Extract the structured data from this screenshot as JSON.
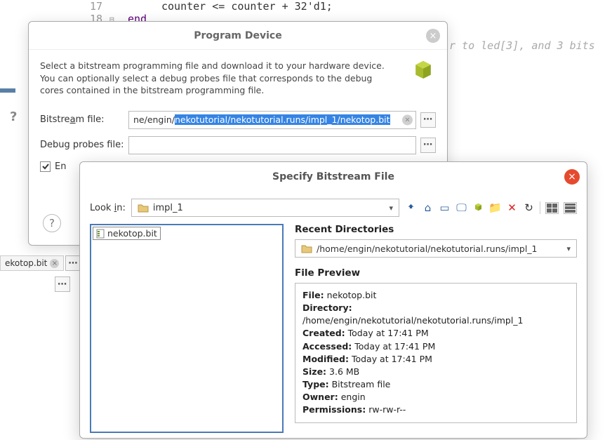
{
  "code": {
    "line17_num": "17",
    "line17_text": "counter <= counter + 32'd1;",
    "line18_num": "18",
    "line18_kw": "end"
  },
  "comment_right": "r to led[3], and 3 bits",
  "background_tab": {
    "label": "ekotop.bit"
  },
  "dlg1": {
    "title": "Program Device",
    "desc": "Select a bitstream programming file and download it to your hardware device. You can optionally select a debug probes file that corresponds to the debug cores contained in the bitstream programming file.",
    "bitstream_label": "Bitstream file:",
    "bitstream_prefix": "ne/engin/",
    "bitstream_sel": "nekotutorial/nekotutorial.runs/impl_1/nekotop.bit",
    "debug_label": "Debug probes file:",
    "debug_value": "",
    "checkbox_label": "En"
  },
  "dlg2": {
    "title": "Specify Bitstream File",
    "lookin_label": "Look in:",
    "lookin_value": "impl_1",
    "file_selected": "nekotop.bit",
    "recent_title": "Recent Directories",
    "recent_value": "/home/engin/nekotutorial/nekotutorial.runs/impl_1",
    "preview_title": "File Preview",
    "preview": {
      "file_k": "File:",
      "file_v": "nekotop.bit",
      "dir_k": "Directory:",
      "dir_v": "/home/engin/nekotutorial/nekotutorial.runs/impl_1",
      "created_k": "Created:",
      "created_v": "Today at 17:41 PM",
      "accessed_k": "Accessed:",
      "accessed_v": "Today at 17:41 PM",
      "modified_k": "Modified:",
      "modified_v": "Today at 17:41 PM",
      "size_k": "Size:",
      "size_v": "3.6 MB",
      "type_k": "Type:",
      "type_v": "Bitstream file",
      "owner_k": "Owner:",
      "owner_v": "engin",
      "perm_k": "Permissions:",
      "perm_v": "rw-rw-r--"
    }
  }
}
